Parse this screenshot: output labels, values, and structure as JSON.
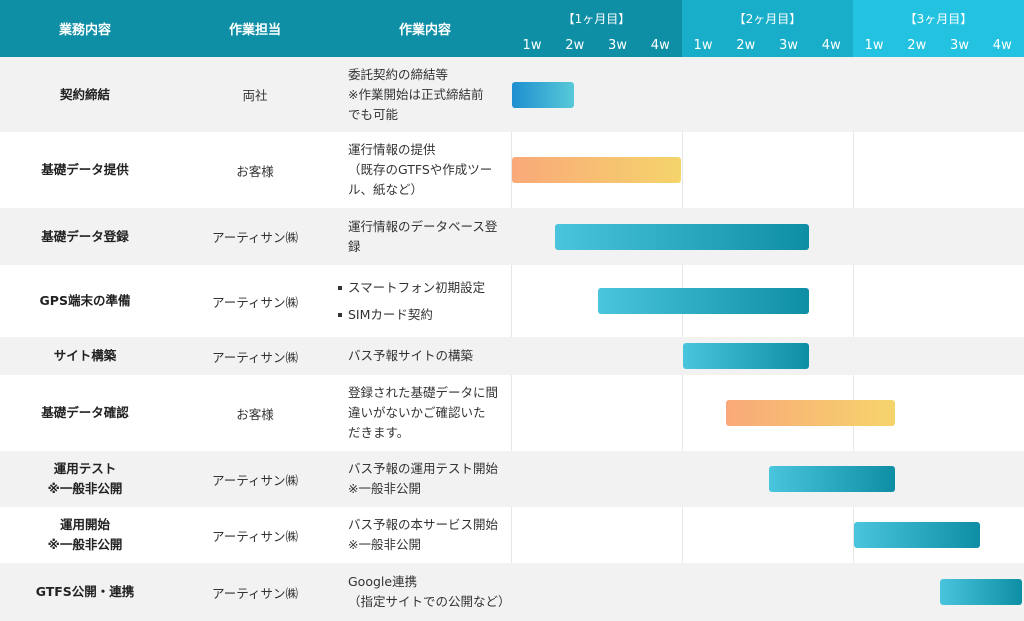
{
  "header": {
    "col_task": "業務内容",
    "col_owner": "作業担当",
    "col_work": "作業内容",
    "months": [
      {
        "label": "【1ヶ月目】",
        "weeks": [
          "1w",
          "2w",
          "3w",
          "4w"
        ]
      },
      {
        "label": "【2ヶ月目】",
        "weeks": [
          "1w",
          "2w",
          "3w",
          "4w"
        ]
      },
      {
        "label": "【3ヶ月目】",
        "weeks": [
          "1w",
          "2w",
          "3w",
          "4w"
        ]
      }
    ]
  },
  "colors": {
    "month1": "#0e8fa6",
    "month2": "#18adc8",
    "month3": "#23c2e0"
  },
  "rows": [
    {
      "task": "契約締結",
      "owner": "両社",
      "work": [
        "委託契約の締結等",
        "※作業開始は正式締結前",
        "でも可能"
      ],
      "bar": {
        "start": 1,
        "end": 1.5,
        "color": "blue"
      }
    },
    {
      "task": "基礎データ提供",
      "owner": "お客様",
      "work": [
        "運行情報の提供",
        "（既存のGTFSや作成ツー",
        "ル、紙など）"
      ],
      "bar": {
        "start": 1,
        "end": 4,
        "color": "orange"
      }
    },
    {
      "task": "基礎データ登録",
      "owner": "アーティサン㈱",
      "work": [
        "運行情報のデータベース登",
        "録"
      ],
      "bar": {
        "start": 2,
        "end": 7,
        "color": "teal"
      }
    },
    {
      "task": "GPS端末の準備",
      "owner": "アーティサン㈱",
      "work": [
        "スマートフォン初期設定",
        "SIMカード契約"
      ],
      "bullets": true,
      "bar": {
        "start": 3,
        "end": 7,
        "color": "teal"
      }
    },
    {
      "task": "サイト構築",
      "owner": "アーティサン㈱",
      "work": [
        "バス予報サイトの構築"
      ],
      "bar": {
        "start": 5,
        "end": 7,
        "color": "teal"
      }
    },
    {
      "task": "基礎データ確認",
      "owner": "お客様",
      "work": [
        "登録された基礎データに間",
        "違いがないかご確認いた",
        "だきます。"
      ],
      "bar": {
        "start": 6,
        "end": 9,
        "color": "orange"
      }
    },
    {
      "task": [
        "運用テスト",
        "※一般非公開"
      ],
      "owner": "アーティサン㈱",
      "work": [
        "バス予報の運用テスト開始",
        "※一般非公開"
      ],
      "bar": {
        "start": 7,
        "end": 9,
        "color": "teal"
      }
    },
    {
      "task": [
        "運用開始",
        "※一般非公開"
      ],
      "owner": "アーティサン㈱",
      "work": [
        "バス予報の本サービス開始",
        "※一般非公開"
      ],
      "bar": {
        "start": 9,
        "end": 11,
        "color": "teal"
      }
    },
    {
      "task": "GTFS公開・連携",
      "owner": "アーティサン㈱",
      "work": [
        "Google連携",
        "（指定サイトでの公開など）"
      ],
      "bar": {
        "start": 11,
        "end": 12,
        "color": "teal"
      }
    }
  ]
}
